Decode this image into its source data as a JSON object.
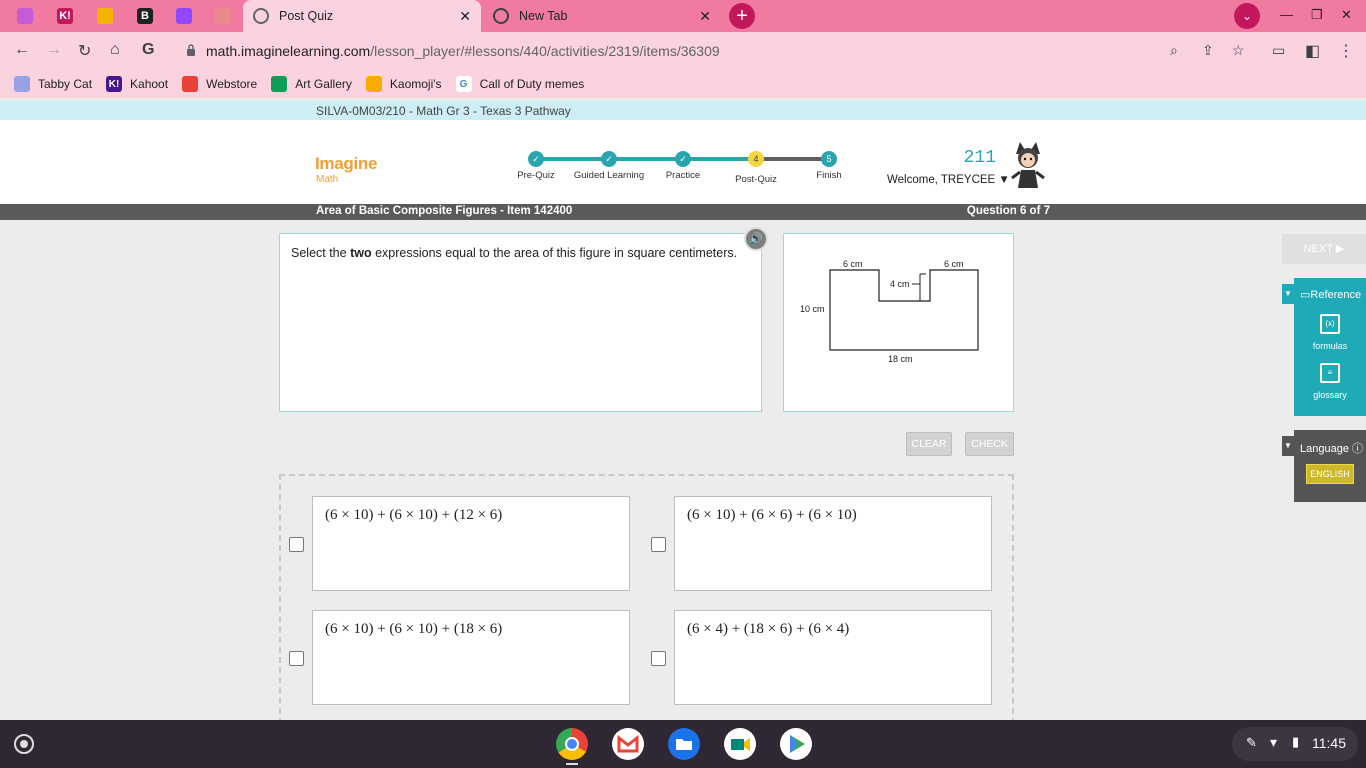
{
  "browser": {
    "tabs": [
      {
        "title": "Post Quiz",
        "active": true
      },
      {
        "title": "New Tab",
        "active": false
      }
    ],
    "pinned_tabs": [
      {
        "icon": "shield-cat-icon",
        "color": "#c55bd6"
      },
      {
        "icon": "kahoot-icon",
        "color": "#c2185b",
        "glyph": "K!"
      },
      {
        "icon": "slides-icon",
        "color": "#f4b400"
      },
      {
        "icon": "bookmark-app-icon",
        "color": "#202124",
        "glyph": "B"
      },
      {
        "icon": "twitch-icon",
        "color": "#9146ff"
      },
      {
        "icon": "webstore-icon",
        "color": "#ea8a8a"
      }
    ],
    "url_host": "math.imaginelearning.com",
    "url_path": "/lesson_player/#lessons/440/activities/2319/items/36309",
    "bookmarks": [
      {
        "label": "Tabby Cat",
        "icon": "tabby-cat-icon",
        "color": "#9aa0e6"
      },
      {
        "label": "Kahoot",
        "icon": "kahoot-icon",
        "color": "#46178f",
        "glyph": "K!"
      },
      {
        "label": "Webstore",
        "icon": "webstore-icon",
        "color": "#ea4335"
      },
      {
        "label": "Art Gallery",
        "icon": "art-gallery-icon",
        "color": "#0f9d58"
      },
      {
        "label": "Kaomoji's",
        "icon": "folder-icon",
        "color": "#f9ab00"
      },
      {
        "label": "Call of Duty memes",
        "icon": "google-icon",
        "color": "#4285f4",
        "glyph": "G"
      }
    ],
    "accent": "#f17ba0"
  },
  "course": {
    "breadcrumb": "SILVA-0M03/210 - Math Gr 3 - Texas 3 Pathway",
    "logo_main": "Imagine",
    "logo_sub": "Math",
    "steps": [
      {
        "label": "Pre-Quiz",
        "state": "done"
      },
      {
        "label": "Guided Learning",
        "state": "done"
      },
      {
        "label": "Practice",
        "state": "done"
      },
      {
        "label": "Post-Quiz",
        "state": "current",
        "number": "4"
      },
      {
        "label": "Finish",
        "state": "todo",
        "number": "5"
      }
    ],
    "score": "211",
    "welcome": "Welcome, TREYCEE"
  },
  "lesson": {
    "title": "Area of Basic Composite Figures - Item 142400",
    "counter": "Question 6 of 7",
    "question_pre": "Select the ",
    "question_bold": "two",
    "question_post": " expressions equal to the area of this figure in square centimeters.",
    "figure": {
      "top_left": "6 cm",
      "top_right": "6 cm",
      "notch": "4 cm",
      "left": "10 cm",
      "bottom": "18 cm"
    },
    "clear_label": "CLEAR",
    "check_label": "CHECK",
    "choices": [
      "(6 × 10) + (6 × 10) + (12 × 6)",
      "(6 × 10) + (6 × 6) + (6 × 10)",
      "(6 × 10) + (6 × 10) + (18 × 6)",
      "(6 × 4) + (18 × 6) + (6 × 4)"
    ]
  },
  "sidebar": {
    "next_label": "NEXT",
    "reference_title": "Reference",
    "formulas_label": "formulas",
    "glossary_label": "glossary",
    "language_title": "Language",
    "english_label": "ENGLISH"
  },
  "shelf": {
    "time": "11:45",
    "apps": [
      {
        "icon": "chrome-icon",
        "color": "#4285f4"
      },
      {
        "icon": "gmail-icon",
        "color": "#ffffff"
      },
      {
        "icon": "files-icon",
        "color": "#1a73e8"
      },
      {
        "icon": "meet-icon",
        "color": "#00897b"
      },
      {
        "icon": "play-store-icon",
        "color": "#ffffff"
      }
    ]
  }
}
